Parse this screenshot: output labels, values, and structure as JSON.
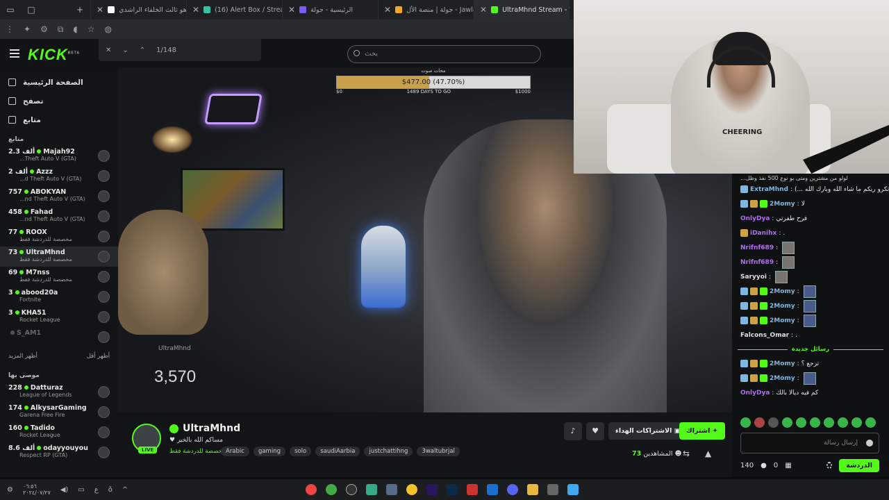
{
  "browser": {
    "tabs": [
      {
        "title": "ما هو ثالث الخلفاء الراشدي",
        "color": "#ffffff"
      },
      {
        "title": "(16) Alert Box / Streamlab",
        "color": "#31c3a2"
      },
      {
        "title": "الرئيسية - جولة",
        "color": "#7a5af8"
      },
      {
        "title": "جولة | منصة الأل - Jawlah",
        "color": "#f5a623"
      },
      {
        "title": "UltraMhnd Stream - W",
        "color": "#53fc18"
      }
    ],
    "find_count": "1/148"
  },
  "kick": {
    "logo": "KICK",
    "logo_sup": "BETA",
    "search_placeholder": "بحث"
  },
  "sidebar": {
    "nav": [
      {
        "label": "الصفحة الرئيسية",
        "icon": "home-icon"
      },
      {
        "label": "تصفح",
        "icon": "browse-icon"
      },
      {
        "label": "متابع",
        "icon": "heart-icon"
      }
    ],
    "following_title": "متابع",
    "following": [
      {
        "count": "2.3 ألف",
        "name": "Majah92",
        "game": "...Theft Auto V (GTA)",
        "online": true
      },
      {
        "count": "2 ألف",
        "name": "Azzz",
        "game": "...d Theft Auto V (GTA)",
        "online": true
      },
      {
        "count": "757",
        "name": "ABOKYAN",
        "game": "...nd Theft Auto V (GTA)",
        "online": true
      },
      {
        "count": "458",
        "name": "Fahad",
        "game": "...nd Theft Auto V (GTA)",
        "online": true
      },
      {
        "count": "77",
        "name": "ROOX",
        "game": "مخصصة للدردشة فقط",
        "online": true
      },
      {
        "count": "73",
        "name": "UltraMhnd",
        "game": "مخصصة للدردشة فقط",
        "online": true,
        "active": true
      },
      {
        "count": "69",
        "name": "M7nss",
        "game": "مخصصة للدردشة فقط",
        "online": true
      },
      {
        "count": "3",
        "name": "abood20a",
        "game": "Fortnite",
        "online": true
      },
      {
        "count": "3",
        "name": "KHA51",
        "game": "Rocket League",
        "online": true
      },
      {
        "count": "",
        "name": "S_AM1",
        "game": "",
        "online": false
      }
    ],
    "show_more": "أظهر المزيد",
    "show_less": "أظهر أقل",
    "recommended_title": "موصى بها",
    "recommended": [
      {
        "count": "228",
        "name": "Datturaz",
        "game": "League of Legends"
      },
      {
        "count": "174",
        "name": "AlkysarGaming",
        "game": "Garena Free Fire"
      },
      {
        "count": "160",
        "name": "Tadido",
        "game": "Rocket League"
      },
      {
        "count": "8.6 ألف",
        "name": "odayyouyou",
        "game": "Respect RP (GTA)"
      }
    ]
  },
  "video": {
    "goal_title": "محات صوت",
    "goal_text": "$477.00 (47.70%)",
    "goal_progress": 0.477,
    "goal_min": "$0",
    "goal_days": "1489 DAYS TO GO",
    "goal_max": "$1000",
    "overlay_name": "UltraMhnd",
    "overlay_count": "3,570"
  },
  "webcam": {
    "shirt_text": "CHEERING"
  },
  "chat": {
    "top_text": "...لولو من مشترين ومتى بو نوع 500 نفذ وظل",
    "messages": [
      {
        "user": "ExtraMhnd",
        "color": "#7fb7e0",
        "text": "(... اتكرو ربكم ما شاء الله وبارك الله) ♥",
        "badges": [
          "blue"
        ]
      },
      {
        "user": "2Momy",
        "color": "#7fb7e0",
        "text": "لا",
        "badges": [
          "blue",
          "gold",
          "green"
        ]
      },
      {
        "user": "OnlyDya",
        "color": "#b06ef0",
        "text": "فرح طفرتي",
        "badges": []
      },
      {
        "user": "iDanihx",
        "color": "#b06ef0",
        "text": ".",
        "badges": [
          "gold"
        ]
      },
      {
        "user": "Nrifnf689",
        "color": "#b06ef0",
        "text": "",
        "badges": [],
        "emote": "gray"
      },
      {
        "user": "Nrifnf689",
        "color": "#b06ef0",
        "text": "",
        "badges": [],
        "emote": "gray"
      },
      {
        "user": "Saryyoi",
        "color": "#e0e0e0",
        "text": "",
        "badges": [],
        "emote": "gray"
      },
      {
        "user": "2Momy",
        "color": "#7fb7e0",
        "text": "",
        "badges": [
          "blue",
          "gold",
          "green"
        ],
        "emote": "blue"
      },
      {
        "user": "2Momy",
        "color": "#7fb7e0",
        "text": "",
        "badges": [
          "blue",
          "gold",
          "green"
        ],
        "emote": "blue"
      },
      {
        "user": "2Momy",
        "color": "#7fb7e0",
        "text": "",
        "badges": [
          "blue",
          "gold",
          "green"
        ],
        "emote": "blue"
      },
      {
        "user": "Falcons_Omar",
        "color": "#e0e0e0",
        "text": ".",
        "badges": []
      }
    ],
    "new_messages": "رسائل جديدة",
    "messages2": [
      {
        "user": "2Momy",
        "color": "#7fb7e0",
        "text": "ترجع ؟",
        "badges": [
          "blue",
          "gold",
          "green"
        ]
      },
      {
        "user": "2Momy",
        "color": "#7fb7e0",
        "text": "",
        "badges": [
          "blue",
          "gold",
          "green"
        ],
        "emote": "blue"
      },
      {
        "user": "OnlyDya",
        "color": "#b06ef0",
        "text": "كم فيه ديالا بالك",
        "badges": []
      }
    ],
    "input_placeholder": "إرسال رسالة",
    "points": "140",
    "gifts": "0",
    "chat_button": "الدردشة"
  },
  "stream": {
    "name": "UltraMhnd",
    "live": "LIVE",
    "title": "♥ مساكم الله بالخير",
    "category": "مخصصة للدردشة فقط",
    "tags": [
      "Arabic",
      "gaming",
      "solo",
      "saudiAarbia",
      "justchattihng",
      "3waltubrjal"
    ],
    "subscribe": "اشتراك",
    "gift_subs": "الاشتراكات الهداء",
    "viewers_label": "المشاهدين",
    "viewers": "73"
  },
  "taskbar": {
    "clock": "٠٦:٥٦",
    "date": "٢٠٢٤/٠٧/٢٧"
  }
}
